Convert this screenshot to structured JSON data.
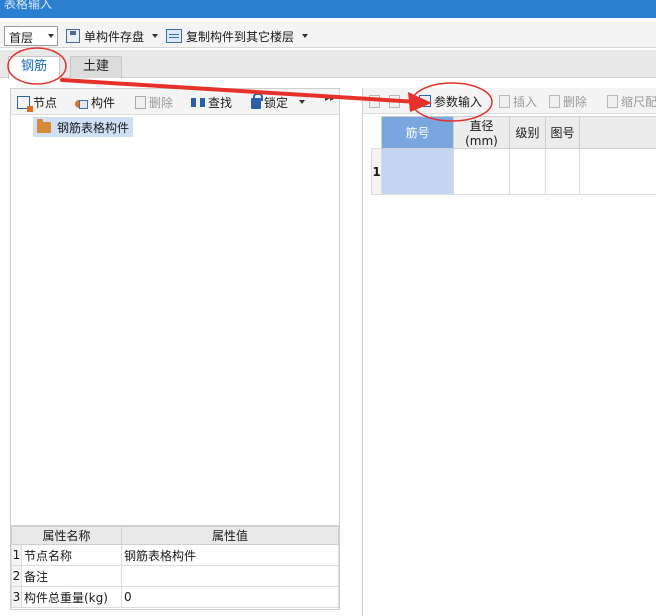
{
  "window": {
    "title": "表格输入"
  },
  "toolbar": {
    "floor_value": "首层",
    "save_component_label": "单构件存盘",
    "copy_to_floors_label": "复制构件到其它楼层"
  },
  "tabs": [
    {
      "label": "钢筋"
    },
    {
      "label": "土建"
    }
  ],
  "left_toolbar": {
    "node_label": "节点",
    "component_label": "构件",
    "delete_label": "删除",
    "find_label": "查找",
    "lock_label": "锁定"
  },
  "tree": {
    "root_label": "钢筋表格构件"
  },
  "properties": {
    "col_name": "属性名称",
    "col_value": "属性值",
    "rows": [
      {
        "idx": "1",
        "name": "节点名称",
        "value": "钢筋表格构件"
      },
      {
        "idx": "2",
        "name": "备注",
        "value": ""
      },
      {
        "idx": "3",
        "name": "构件总重量(kg)",
        "value": "0"
      }
    ]
  },
  "right_toolbar": {
    "param_input_label": "参数输入",
    "insert_label": "插入",
    "delete_label": "删除",
    "scale_label": "缩尺配"
  },
  "grid": {
    "headers": [
      "筋号",
      "直径(mm)",
      "级别",
      "图号"
    ],
    "row_number": "1"
  },
  "colors": {
    "title_bar": "#2b7fd1",
    "annotation_red": "#e8302a",
    "selection_blue": "#c3d5f0"
  }
}
